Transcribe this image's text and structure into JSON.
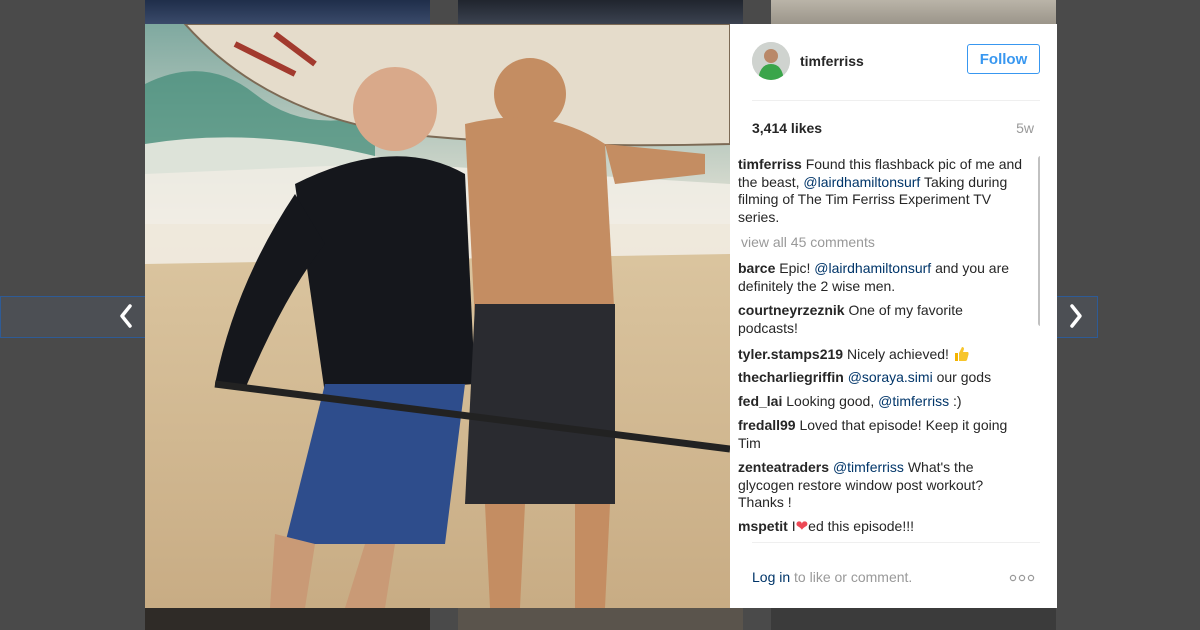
{
  "post": {
    "username": "timferriss",
    "follow_label": "Follow",
    "likes": "3,414 likes",
    "age": "5w",
    "caption": {
      "username": "timferriss",
      "text_before": "Found this flashback pic of me and the beast,",
      "mention": "@lairdhamiltonsurf",
      "text_after": "Taking during filming of The Tim Ferriss Experiment TV series."
    },
    "view_all": "view all 45 comments"
  },
  "comments": [
    {
      "user": "barce",
      "pre": "Epic!",
      "mention": "@lairdhamiltonsurf",
      "post": "and you are definitely the 2 wise men."
    },
    {
      "user": "courtneyrzeznik",
      "pre": "One of my favorite podcasts!",
      "mention": "",
      "post": ""
    },
    {
      "user": "tyler.stamps219",
      "pre": "Nicely achieved!",
      "mention": "",
      "post": "",
      "emoji": "thumbs-up"
    },
    {
      "user": "thecharliegriffin",
      "pre": "",
      "mention": "@soraya.simi",
      "post": "our gods"
    },
    {
      "user": "fed_lai",
      "pre": "Looking good,",
      "mention": "@timferriss",
      "post": ":)"
    },
    {
      "user": "fredall99",
      "pre": "Loved that episode! Keep it going Tim",
      "mention": "",
      "post": ""
    },
    {
      "user": "zenteatraders",
      "pre": "",
      "mention": "@timferriss",
      "post": "What's the glycogen restore window post workout? Thanks !"
    },
    {
      "user": "mspetit",
      "pre": "I",
      "mention": "",
      "post": "ed this episode!!!",
      "emoji": "heart"
    }
  ],
  "footer": {
    "login_link": "Log in",
    "login_rest": "to like or comment."
  },
  "colors": {
    "accent": "#3897f0",
    "mention": "#003569",
    "muted": "#999999",
    "overlay": "#4a4a4a"
  },
  "icons": [
    "chevron-left-icon",
    "chevron-right-icon",
    "more-options-icon",
    "thumbs-up-emoji",
    "heart-emoji"
  ]
}
